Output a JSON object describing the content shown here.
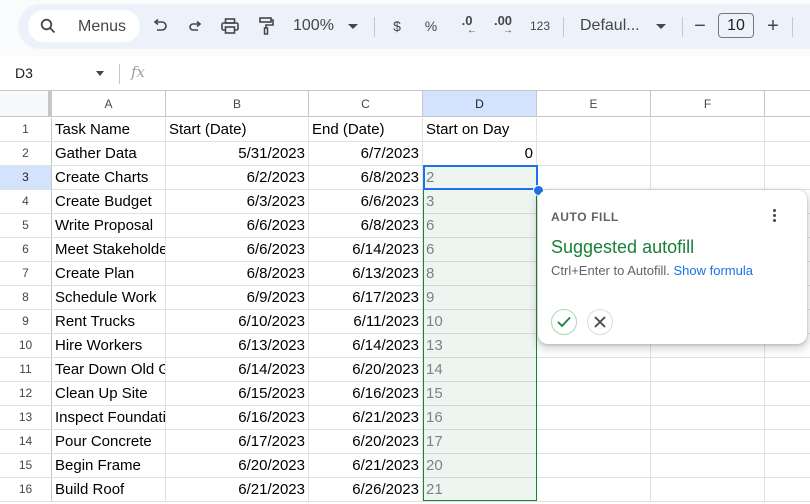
{
  "toolbar": {
    "menus_label": "Menus",
    "zoom": "100%",
    "currency": "$",
    "percent": "%",
    "decrease_decimal": ".0",
    "increase_decimal": ".00",
    "more_formats": "123",
    "font": "Defaul...",
    "font_size": "10",
    "minus": "−",
    "plus": "+",
    "icons": [
      "search-icon",
      "undo-icon",
      "redo-icon",
      "print-icon",
      "paint-format-icon"
    ]
  },
  "formula_bar": {
    "name_box": "D3",
    "fx_label": "fx",
    "value": ""
  },
  "columns": [
    "A",
    "B",
    "C",
    "D",
    "E",
    "F",
    ""
  ],
  "selected_column": "D",
  "selected_row": 3,
  "rows": [
    {
      "num": "1",
      "a": "Task Name",
      "b": "Start (Date)",
      "c": "End (Date)",
      "d": "Start on Day"
    },
    {
      "num": "2",
      "a": "Gather Data",
      "b": "5/31/2023",
      "c": "6/7/2023",
      "d": "0"
    },
    {
      "num": "3",
      "a": "Create Charts",
      "b": "6/2/2023",
      "c": "6/8/2023",
      "d": "2"
    },
    {
      "num": "4",
      "a": "Create Budget",
      "b": "6/3/2023",
      "c": "6/6/2023",
      "d": "3"
    },
    {
      "num": "5",
      "a": "Write Proposal",
      "b": "6/6/2023",
      "c": "6/8/2023",
      "d": "6"
    },
    {
      "num": "6",
      "a": "Meet Stakeholders",
      "b": "6/6/2023",
      "c": "6/14/2023",
      "d": "6"
    },
    {
      "num": "7",
      "a": "Create Plan",
      "b": "6/8/2023",
      "c": "6/13/2023",
      "d": "8"
    },
    {
      "num": "8",
      "a": "Schedule Work",
      "b": "6/9/2023",
      "c": "6/17/2023",
      "d": "9"
    },
    {
      "num": "9",
      "a": "Rent Trucks",
      "b": "6/10/2023",
      "c": "6/11/2023",
      "d": "10"
    },
    {
      "num": "10",
      "a": "Hire Workers",
      "b": "6/13/2023",
      "c": "6/14/2023",
      "d": "13"
    },
    {
      "num": "11",
      "a": "Tear Down Old Garage",
      "b": "6/14/2023",
      "c": "6/20/2023",
      "d": "14"
    },
    {
      "num": "12",
      "a": "Clean Up Site",
      "b": "6/15/2023",
      "c": "6/16/2023",
      "d": "15"
    },
    {
      "num": "13",
      "a": "Inspect Foundation",
      "b": "6/16/2023",
      "c": "6/21/2023",
      "d": "16"
    },
    {
      "num": "14",
      "a": "Pour Concrete",
      "b": "6/17/2023",
      "c": "6/20/2023",
      "d": "17"
    },
    {
      "num": "15",
      "a": "Begin Frame",
      "b": "6/20/2023",
      "c": "6/21/2023",
      "d": "20"
    },
    {
      "num": "16",
      "a": "Build Roof",
      "b": "6/21/2023",
      "c": "6/26/2023",
      "d": "21"
    }
  ],
  "autofill_popup": {
    "title": "AUTO FILL",
    "heading": "Suggested autofill",
    "hint": "Ctrl+Enter to Autofill.",
    "link": "Show formula",
    "colors": {
      "heading": "#188038",
      "link": "#1a73e8",
      "selection": "#1a73e8",
      "fill_border": "#188038"
    }
  }
}
